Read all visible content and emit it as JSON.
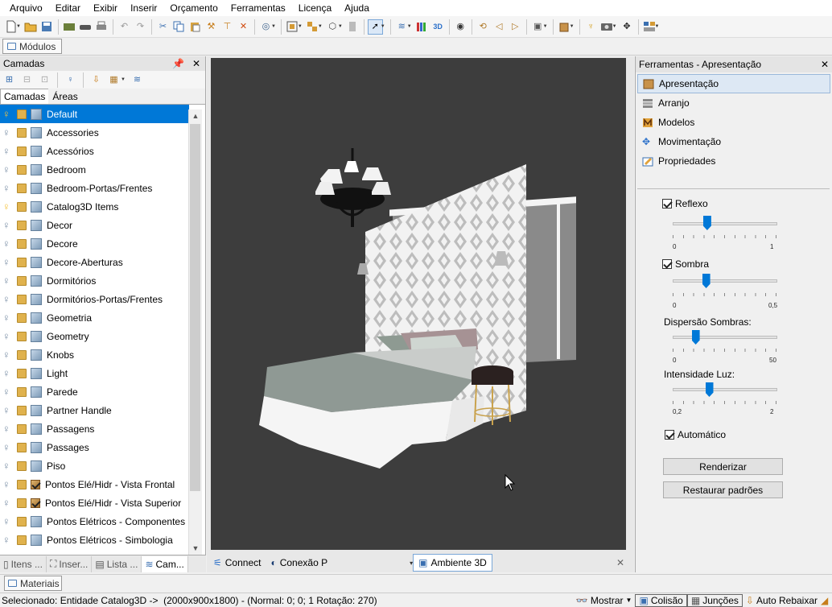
{
  "menu": [
    "Arquivo",
    "Editar",
    "Exibir",
    "Inserir",
    "Orçamento",
    "Ferramentas",
    "Licença",
    "Ajuda"
  ],
  "modules_tab": "Módulos",
  "layers_panel": {
    "title": "Camadas",
    "pin": "❘",
    "close": "✕",
    "tabs": [
      "Camadas",
      "Áreas"
    ],
    "items": [
      {
        "name": "Default",
        "selected": true,
        "bulb_on": true,
        "icon": "cube"
      },
      {
        "name": "Accessories",
        "icon": "cube"
      },
      {
        "name": "Acessórios",
        "icon": "cube"
      },
      {
        "name": "Bedroom",
        "icon": "cube"
      },
      {
        "name": "Bedroom-Portas/Frentes",
        "icon": "cube"
      },
      {
        "name": "Catalog3D Items",
        "bulb_on": true,
        "icon": "cube"
      },
      {
        "name": "Decor",
        "icon": "cube"
      },
      {
        "name": "Decore",
        "icon": "cube"
      },
      {
        "name": "Decore-Aberturas",
        "icon": "cube"
      },
      {
        "name": "Dormitórios",
        "icon": "cube"
      },
      {
        "name": "Dormitórios-Portas/Frentes",
        "icon": "cube"
      },
      {
        "name": "Geometria",
        "icon": "cube"
      },
      {
        "name": "Geometry",
        "icon": "cube"
      },
      {
        "name": "Knobs",
        "icon": "cube"
      },
      {
        "name": "Light",
        "icon": "cube"
      },
      {
        "name": "Parede",
        "icon": "cube"
      },
      {
        "name": "Partner Handle",
        "icon": "cube"
      },
      {
        "name": "Passagens",
        "icon": "cube"
      },
      {
        "name": "Passages",
        "icon": "cube"
      },
      {
        "name": "Piso",
        "icon": "cube"
      },
      {
        "name": "Pontos Elé/Hidr - Vista Frontal",
        "icon": "box"
      },
      {
        "name": "Pontos Elé/Hidr - Vista Superior",
        "icon": "box"
      },
      {
        "name": "Pontos Elétricos - Componentes",
        "icon": "cube"
      },
      {
        "name": "Pontos Elétricos - Simbologia",
        "icon": "cube"
      }
    ],
    "bottom_tabs": [
      "Itens ...",
      "Inser...",
      "Lista ...",
      "Cam..."
    ]
  },
  "view_tabs": {
    "connect": "Connect",
    "conexao": "Conexão P",
    "ambiente": "Ambiente 3D",
    "close": "✕"
  },
  "tools_panel": {
    "title": "Ferramentas - Apresentação",
    "items": [
      "Apresentação",
      "Arranjo",
      "Modelos",
      "Movimentação",
      "Propriedades"
    ],
    "reflexo": "Reflexo",
    "reflexo_min": "0",
    "reflexo_max": "1",
    "sombra": "Sombra",
    "sombra_min": "0",
    "sombra_max": "0,5",
    "dispersao": "Dispersão Sombras:",
    "dispersao_min": "0",
    "dispersao_max": "50",
    "intensidade": "Intensidade Luz:",
    "intensidade_min": "0,2",
    "intensidade_max": "2",
    "automatico": "Automático",
    "render_btn": "Renderizar",
    "restore_btn": "Restaurar padrões",
    "slider_levels": {
      "reflexo": 0.33,
      "sombra": 0.32,
      "dispersao": 0.22,
      "intensidade": 0.35
    }
  },
  "materials_tab": "Materiais",
  "status": {
    "text": "Selecionado: Entidade Catalog3D ->  (2000x900x1800) - (Normal: 0; 0; 1 Rotação: 270)",
    "mostrar": "Mostrar",
    "colisao": "Colisão",
    "juncoes": "Junções",
    "auto_rebaixar": "Auto Rebaixar"
  },
  "colors": {
    "accent": "#0078d7",
    "viewport_bg": "#3d3d3d"
  }
}
